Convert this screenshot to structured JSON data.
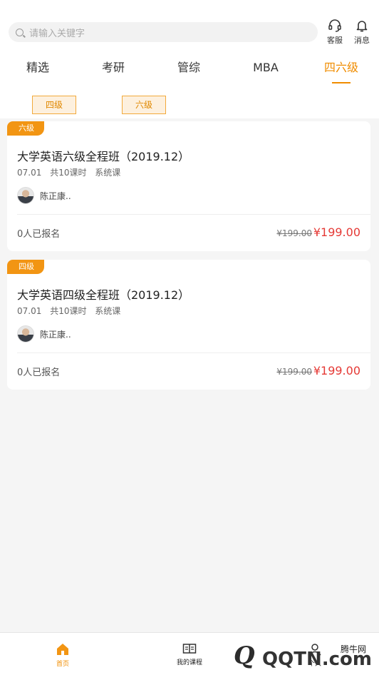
{
  "search": {
    "placeholder": "请输入关键字"
  },
  "header": {
    "service_label": "客服",
    "message_label": "消息"
  },
  "tabs": [
    {
      "label": "精选"
    },
    {
      "label": "考研"
    },
    {
      "label": "管综"
    },
    {
      "label": "MBA"
    },
    {
      "label": "四六级"
    }
  ],
  "active_tab": "四六级",
  "filters": [
    {
      "label": "四级"
    },
    {
      "label": "六级"
    }
  ],
  "courses": [
    {
      "badge": "六级",
      "title": "大学英语六级全程班（2019.12）",
      "date": "07.01",
      "lessons": "共10课时",
      "type": "系统课",
      "teacher": "陈正康..",
      "enrolled": "0人已报名",
      "original_price": "¥199.00",
      "price": "¥199.00"
    },
    {
      "badge": "四级",
      "title": "大学英语四级全程班（2019.12）",
      "date": "07.01",
      "lessons": "共10课时",
      "type": "系统课",
      "teacher": "陈正康..",
      "enrolled": "0人已报名",
      "original_price": "¥199.00",
      "price": "¥199.00"
    }
  ],
  "bottom_nav": {
    "home_label": "首页",
    "courses_label": "我的课程",
    "mine_label": "个人"
  },
  "watermark": {
    "site": "腾牛网",
    "logo": "Q",
    "text": "QQTN.com"
  },
  "colors": {
    "accent": "#f08c00",
    "price": "#e53935",
    "badge": "#f29513"
  }
}
